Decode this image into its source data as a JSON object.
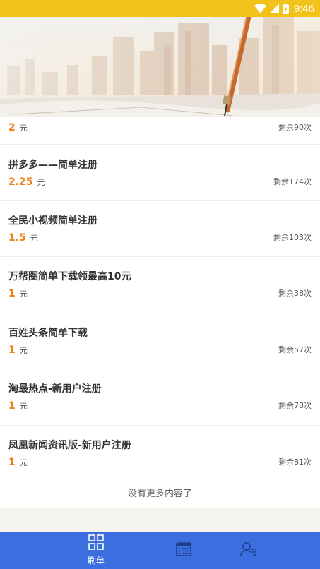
{
  "status_bar": {
    "time": "9:46",
    "icons": [
      "wifi-icon",
      "signal-icon",
      "battery-charging-icon"
    ]
  },
  "banner": {
    "description": "city-skyline-and-pen-photo"
  },
  "tasks": [
    {
      "title": "",
      "price": "2",
      "unit": "元",
      "remaining": "剩余90次"
    },
    {
      "title": "拼多多——简单注册",
      "price": "2.25",
      "unit": "元",
      "remaining": "剩余174次"
    },
    {
      "title": "全民小视频简单注册",
      "price": "1.5",
      "unit": "元",
      "remaining": "剩余103次"
    },
    {
      "title": "万帮圈简单下载领最高10元",
      "price": "1",
      "unit": "元",
      "remaining": "剩余38次"
    },
    {
      "title": "百姓头条简单下载",
      "price": "1",
      "unit": "元",
      "remaining": "剩余57次"
    },
    {
      "title": "淘最热点-新用户注册",
      "price": "1",
      "unit": "元",
      "remaining": "剩余78次"
    },
    {
      "title": "凤凰新闻资讯版-新用户注册",
      "price": "1",
      "unit": "元",
      "remaining": "剩余81次"
    }
  ],
  "list_end_text": "没有更多内容了",
  "bottom_nav": {
    "items": [
      {
        "label": "刷单",
        "icon": "grid-icon",
        "active": true
      },
      {
        "label": "",
        "icon": "list-icon",
        "active": false
      },
      {
        "label": "",
        "icon": "user-list-icon",
        "active": false
      }
    ]
  },
  "colors": {
    "status_bar": "#f2c21a",
    "price": "#f07e11",
    "bottom_nav": "#3b6fe0"
  }
}
